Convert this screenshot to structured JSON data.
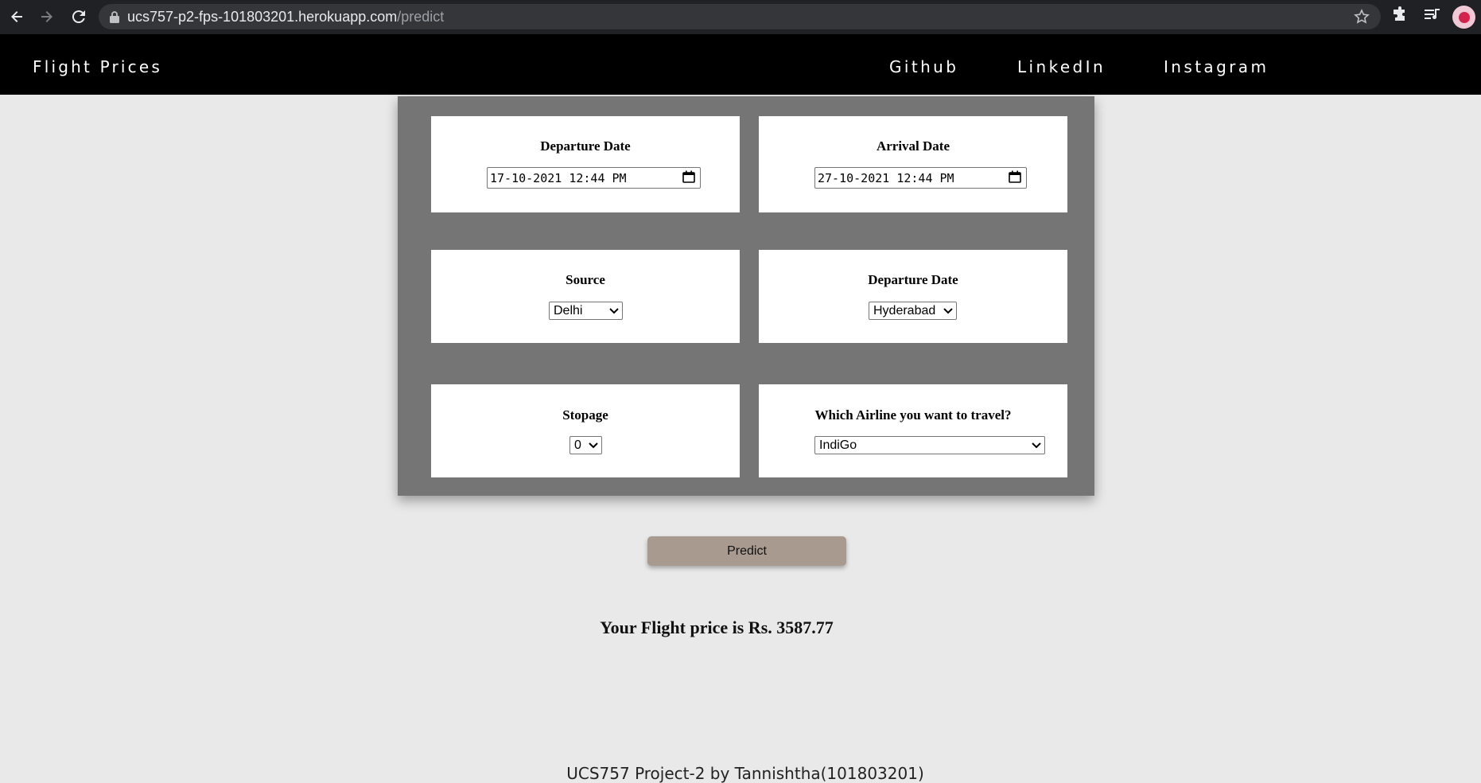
{
  "browser": {
    "url_host": "ucs757-p2-fps-101803201.herokuapp.com",
    "url_path": "/predict"
  },
  "nav": {
    "brand": "Flight Prices",
    "links": [
      "Github",
      "LinkedIn",
      "Instagram"
    ]
  },
  "form": {
    "departure": {
      "label": "Departure Date",
      "value": "17-10-2021 12:44 PM"
    },
    "arrival": {
      "label": "Arrival Date",
      "value": "27-10-2021 12:44 PM"
    },
    "source": {
      "label": "Source",
      "value": "Delhi"
    },
    "destination": {
      "label": "Departure Date",
      "value": "Hyderabad"
    },
    "stopage": {
      "label": "Stopage",
      "value": "0"
    },
    "airline": {
      "label": "Which Airline you want to travel?",
      "value": "IndiGo"
    }
  },
  "predict_label": "Predict",
  "result_text": "Your Flight price is Rs. 3587.77",
  "footer_text": "UCS757 Project-2 by Tannishtha(101803201)"
}
